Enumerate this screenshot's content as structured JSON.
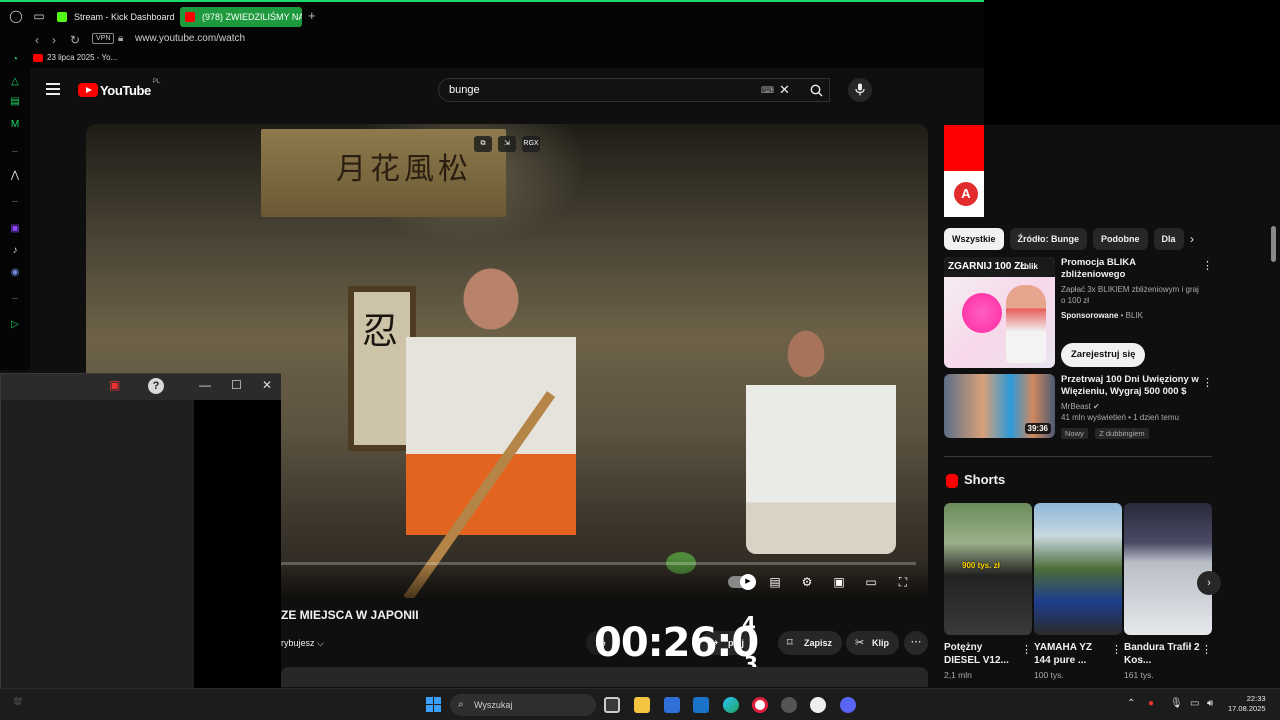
{
  "browser": {
    "tabs": [
      {
        "label": "Stream - Kick Dashboard"
      },
      {
        "label": "(978) ZWIEDZILIŚMY NA..."
      }
    ],
    "url": "www.youtube.com/watch",
    "vpn_label": "VPN",
    "bookmark": "23 lipca 2025 - Yo..."
  },
  "youtube": {
    "logo_text": "YouTube",
    "region": "PL",
    "search_value": "bunge",
    "overlay_badge": "RGX",
    "video_title": "ZE MIEJSCA W JAPONII",
    "subscribe_label": "rybujesz",
    "actions": {
      "share": "pnij",
      "save": "Zapisz",
      "clip": "Klip"
    },
    "timer": {
      "main": "00:26:0",
      "top": "4",
      "bottom": "3"
    }
  },
  "sidebar_right": {
    "chips": [
      "Wszystkie",
      "Źródło: Bunge",
      "Podobne",
      "Dla"
    ],
    "recs": [
      {
        "title": "Promocja BLIKA zbliżeniowego",
        "desc": "Zapłać 3x BLIKIEM zbliżeniowym i graj o 100 zł",
        "sponsored": "Sponsorowane",
        "sponsor": "BLIK",
        "cta": "Zarejestruj się",
        "thumb_text": "ZGARNIJ 100 ZŁ",
        "thumb_brand": "blik"
      },
      {
        "title": "Przetrwaj 100 Dni Uwięziony w Więzieniu, Wygraj 500 000 $",
        "channel": "MrBeast",
        "stats": "41 mln wyświetleń • 1 dzień temu",
        "tags": [
          "Nowy",
          "Z dubbingiem"
        ],
        "duration": "39:36"
      }
    ],
    "shorts_header": "Shorts",
    "shorts": [
      {
        "title": "Potężny DIESEL V12...",
        "views": "2,1 mln",
        "overlay": "900 tys. zł"
      },
      {
        "title": "YAMAHA YZ 144 pure ...",
        "views": "100 tys."
      },
      {
        "title": "Bandura Trafił 2 Kos...",
        "views": "161 tys."
      }
    ]
  },
  "taskbar": {
    "search_placeholder": "Wyszukaj",
    "time": "22:33",
    "date": "17.08.2025"
  },
  "colors": {
    "accent_green": "#1bd96a",
    "youtube_red": "#ff0000",
    "bg": "#0f0f0f"
  }
}
